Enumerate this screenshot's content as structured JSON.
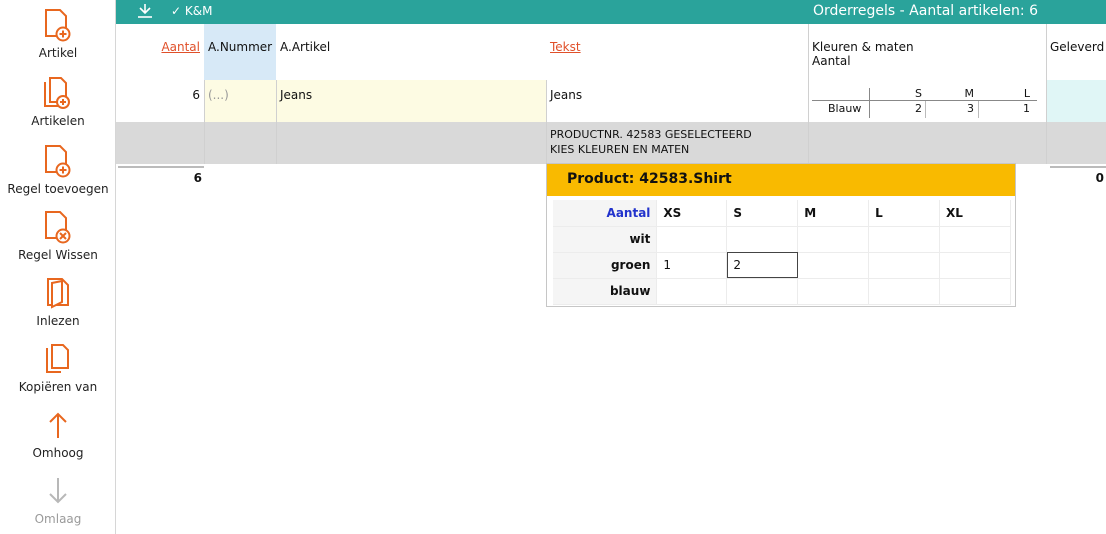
{
  "toolbar": {
    "items": [
      {
        "label": "Artikel",
        "icon": "doc-add-icon"
      },
      {
        "label": "Artikelen",
        "icon": "docs-add-icon"
      },
      {
        "label": "Regel toevoegen",
        "icon": "doc-add-icon"
      },
      {
        "label": "Regel Wissen",
        "icon": "doc-delete-icon"
      },
      {
        "label": "Inlezen",
        "icon": "doc-import-icon"
      },
      {
        "label": "Kopiëren van",
        "icon": "doc-copy-icon"
      },
      {
        "label": "Omhoog",
        "icon": "arrow-up-icon"
      },
      {
        "label": "Omlaag",
        "icon": "arrow-down-icon"
      }
    ]
  },
  "header": {
    "check_label": "✓ K&M",
    "title": "Orderregels - Aantal artikelen: 6"
  },
  "columns": {
    "aantal": "Aantal",
    "anummer": "A.Nummer",
    "aartikel": "A.Artikel",
    "tekst": "Tekst",
    "kleuren": "Kleuren & maten",
    "kleuren_sub": "Aantal",
    "geleverd": "Geleverd"
  },
  "row1": {
    "aantal": "6",
    "anummer": "(...)",
    "aartikel": "Jeans",
    "tekst": "Jeans",
    "sizes_head": [
      "S",
      "M",
      "L"
    ],
    "color": "Blauw",
    "sizes_values": [
      "2",
      "3",
      "1"
    ]
  },
  "row2": {
    "tekst_line1": "PRODUCTNR. 42583 GESELECTEERD",
    "tekst_line2": "KIES KLEUREN EN MATEN"
  },
  "totals": {
    "aantal": "6",
    "geleverd": "0"
  },
  "popup": {
    "title": "Product: 42583.Shirt",
    "header_label": "Aantal",
    "sizes": [
      "XS",
      "S",
      "M",
      "L",
      "XL"
    ],
    "rows": [
      {
        "color": "wit",
        "values": [
          "",
          "",
          "",
          "",
          ""
        ]
      },
      {
        "color": "groen",
        "values": [
          "1",
          "2",
          "",
          "",
          ""
        ]
      },
      {
        "color": "blauw",
        "values": [
          "",
          "",
          "",
          "",
          ""
        ]
      }
    ]
  },
  "colors": {
    "header_bg": "#2aa39b",
    "accent_orange": "#e0502a",
    "popup_header": "#f9ba00"
  }
}
